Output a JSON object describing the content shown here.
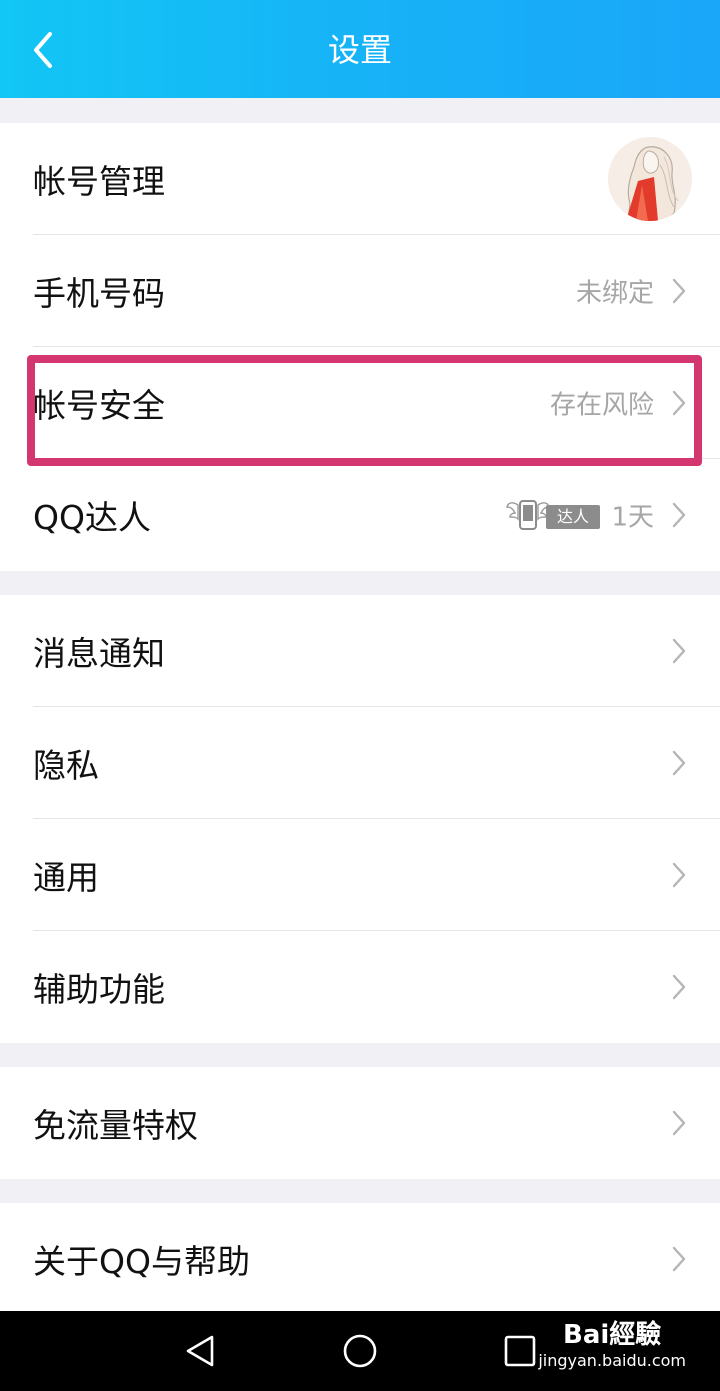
{
  "header": {
    "title": "设置"
  },
  "groups": {
    "account": {
      "account_management": {
        "label": "帐号管理"
      },
      "phone_number": {
        "label": "手机号码",
        "value": "未绑定"
      },
      "account_security": {
        "label": "帐号安全",
        "value": "存在风险"
      },
      "qq_daren": {
        "label": "QQ达人",
        "badge": "达人",
        "value": "1天"
      }
    },
    "general": {
      "notifications": {
        "label": "消息通知"
      },
      "privacy": {
        "label": "隐私"
      },
      "general": {
        "label": "通用"
      },
      "accessibility": {
        "label": "辅助功能"
      }
    },
    "data": {
      "free_traffic": {
        "label": "免流量特权"
      }
    },
    "about": {
      "about_help": {
        "label": "关于QQ与帮助"
      }
    }
  },
  "watermark": {
    "logo": "Bai經驗",
    "url": "jingyan.baidu.com"
  },
  "icons": {
    "back": "chevron-left-icon",
    "row_arrow": "chevron-right-icon",
    "nav_back": "triangle-back-icon",
    "nav_home": "circle-home-icon",
    "nav_recents": "square-recents-icon"
  },
  "colors": {
    "header_start": "#12c6f5",
    "header_end": "#1aa6f9",
    "highlight": "#d4376f",
    "page_bg": "#f0f0f5"
  }
}
